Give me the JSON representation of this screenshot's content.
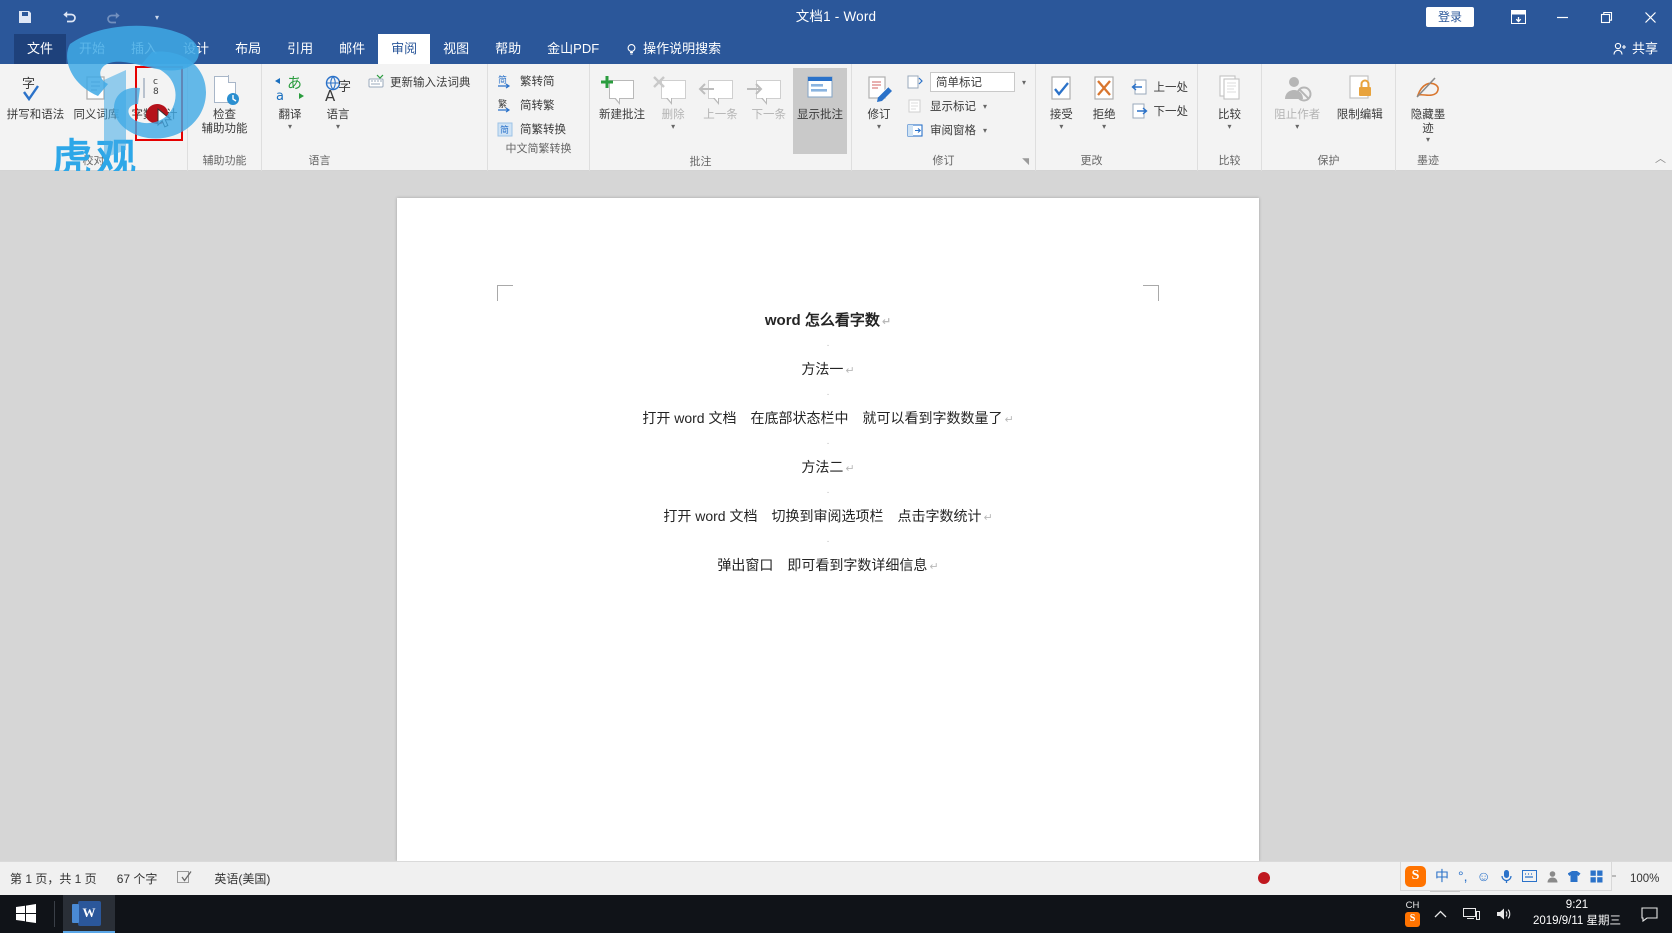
{
  "window": {
    "title": "文档1 - Word",
    "signin_label": "登录",
    "share_label": "共享",
    "quick_access": [
      "save-icon",
      "undo-icon",
      "redo-icon",
      "customize-qat-caret"
    ],
    "buttons": [
      "ribbon-display-options",
      "minimize",
      "restore",
      "close"
    ]
  },
  "tabs": [
    {
      "label": "文件",
      "active": false,
      "kind": "file"
    },
    {
      "label": "开始",
      "active": false,
      "kind": "normal"
    },
    {
      "label": "插入",
      "active": false,
      "kind": "normal"
    },
    {
      "label": "设计",
      "active": false,
      "kind": "normal"
    },
    {
      "label": "布局",
      "active": false,
      "kind": "normal"
    },
    {
      "label": "引用",
      "active": false,
      "kind": "normal"
    },
    {
      "label": "邮件",
      "active": false,
      "kind": "normal"
    },
    {
      "label": "审阅",
      "active": true,
      "kind": "normal"
    },
    {
      "label": "视图",
      "active": false,
      "kind": "normal"
    },
    {
      "label": "帮助",
      "active": false,
      "kind": "normal"
    },
    {
      "label": "金山PDF",
      "active": false,
      "kind": "normal"
    },
    {
      "label": "操作说明搜索",
      "active": false,
      "kind": "search"
    }
  ],
  "ribbon": {
    "groups": [
      {
        "name": "校对",
        "label": "校对",
        "items": [
          {
            "label": "拼写和语法",
            "icon": "spelling-grammar-icon",
            "type": "big",
            "disabled": false
          },
          {
            "label": "同义词库",
            "icon": "thesaurus-icon",
            "type": "big",
            "disabled": false
          },
          {
            "label": "字数统计",
            "icon": "word-count-icon",
            "type": "big",
            "disabled": false,
            "highlighted": true
          }
        ]
      },
      {
        "name": "辅助功能",
        "label": "辅助功能",
        "items": [
          {
            "label": "检查\n辅助功能",
            "icon": "check-accessibility-icon",
            "type": "big",
            "dropdown": true
          }
        ]
      },
      {
        "name": "语言",
        "label": "语言",
        "items": [
          {
            "label": "翻译",
            "icon": "translate-icon",
            "type": "big",
            "dropdown": true
          },
          {
            "label": "语言",
            "icon": "language-icon",
            "type": "big",
            "dropdown": true
          },
          {
            "label": "更新输入法词典",
            "icon": "update-ime-dictionary-icon",
            "type": "small"
          }
        ]
      },
      {
        "name": "中文简繁转换",
        "label": "中文简繁转换",
        "items": [
          {
            "label": "繁转简",
            "icon": "trad-to-simp-icon",
            "type": "small"
          },
          {
            "label": "简转繁",
            "icon": "simp-to-trad-icon",
            "type": "small"
          },
          {
            "label": "简繁转换",
            "icon": "simp-trad-convert-icon",
            "type": "small"
          }
        ]
      },
      {
        "name": "批注",
        "label": "批注",
        "items": [
          {
            "label": "新建批注",
            "icon": "new-comment-icon",
            "type": "big",
            "disabled": false
          },
          {
            "label": "删除",
            "icon": "delete-comment-icon",
            "type": "big",
            "disabled": true,
            "dropdown": true
          },
          {
            "label": "上一条",
            "icon": "previous-comment-icon",
            "type": "big",
            "disabled": true
          },
          {
            "label": "下一条",
            "icon": "next-comment-icon",
            "type": "big",
            "disabled": true
          },
          {
            "label": "显示批注",
            "icon": "show-comments-icon",
            "type": "big",
            "selected": true
          }
        ]
      },
      {
        "name": "修订",
        "label": "修订",
        "items": [
          {
            "label": "修订",
            "icon": "track-changes-icon",
            "type": "big",
            "dropdown": true
          },
          {
            "label": "简单标记",
            "icon": "markup-dropdown-icon",
            "type": "small",
            "dropdown": true,
            "boxed": true
          },
          {
            "label": "显示标记",
            "icon": "show-markup-icon",
            "type": "small",
            "dropdown": true
          },
          {
            "label": "审阅窗格",
            "icon": "reviewing-pane-icon",
            "type": "small",
            "dropdown": true
          }
        ]
      },
      {
        "name": "更改",
        "label": "更改",
        "items": [
          {
            "label": "接受",
            "icon": "accept-icon",
            "type": "big",
            "dropdown": true
          },
          {
            "label": "拒绝",
            "icon": "reject-icon",
            "type": "big",
            "dropdown": true
          },
          {
            "label": "上一处",
            "icon": "previous-change-icon",
            "type": "small"
          },
          {
            "label": "下一处",
            "icon": "next-change-icon",
            "type": "small"
          }
        ]
      },
      {
        "name": "比较",
        "label": "比较",
        "items": [
          {
            "label": "比较",
            "icon": "compare-icon",
            "type": "big",
            "dropdown": true
          }
        ]
      },
      {
        "name": "保护",
        "label": "保护",
        "items": [
          {
            "label": "阻止作者",
            "icon": "block-authors-icon",
            "type": "big",
            "disabled": true,
            "dropdown": true
          },
          {
            "label": "限制编辑",
            "icon": "restrict-editing-icon",
            "type": "big",
            "disabled": false
          }
        ]
      },
      {
        "name": "墨迹",
        "label": "墨迹",
        "items": [
          {
            "label": "隐藏墨\n迹",
            "icon": "hide-ink-icon",
            "type": "big",
            "dropdown": true
          }
        ]
      }
    ]
  },
  "document": {
    "lines": [
      {
        "text": "word 怎么看字数",
        "style": "title"
      },
      {
        "text": "",
        "style": "blank"
      },
      {
        "text": "方法一",
        "style": "body"
      },
      {
        "text": "",
        "style": "blank"
      },
      {
        "text": "打开 word 文档　在底部状态栏中　就可以看到字数数量了",
        "style": "body"
      },
      {
        "text": "",
        "style": "blank"
      },
      {
        "text": "方法二",
        "style": "body"
      },
      {
        "text": "",
        "style": "blank"
      },
      {
        "text": "打开 word 文档　切换到审阅选项栏　点击字数统计",
        "style": "body"
      },
      {
        "text": "",
        "style": "blank"
      },
      {
        "text": "弹出窗口　即可看到字数详细信息",
        "style": "body"
      }
    ]
  },
  "statusbar": {
    "page_info": "第 1 页，共 1 页",
    "word_count": "67 个字",
    "proofing_icon": "proofing-errors-icon",
    "language": "英语(美国)",
    "views": [
      "read-mode-icon",
      "print-layout-icon",
      "web-layout-icon"
    ],
    "active_view": "print-layout-icon",
    "zoom_level": "100%"
  },
  "ime_toolbar": {
    "logo": "S",
    "items": [
      "中",
      "traditional-toggle-icon",
      "emoji-icon",
      "voice-input-icon",
      "soft-keyboard-icon",
      "user-icon",
      "skin-icon",
      "toolbox-icon"
    ]
  },
  "taskbar": {
    "start": "windows-start-icon",
    "tasks": [
      {
        "label": "Word",
        "icon": "word-icon",
        "active": true
      }
    ],
    "tray": {
      "ime_label": "CH",
      "ime_logo": "S",
      "icons": [
        "show-hidden-icons-chevron",
        "network-icon",
        "volume-icon"
      ],
      "time": "9:21",
      "date": "2019/9/11 星期三",
      "action_center": "action-center-icon"
    }
  },
  "overlay": {
    "watermark_text": "虎观",
    "highlight_target": "字数统计"
  },
  "colors": {
    "brand": "#2b579a",
    "ribbon_bg": "#f3f3f3",
    "highlight_red": "#e60000",
    "taskbar": "#101318",
    "watermark_blue": "#2da7e8"
  }
}
